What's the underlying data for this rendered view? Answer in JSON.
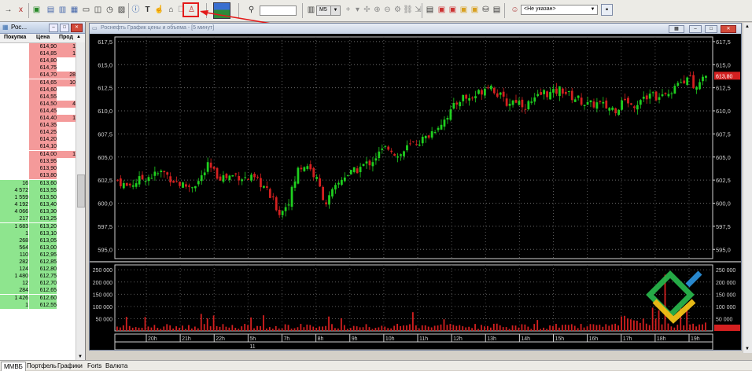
{
  "toolbar": {
    "timeframe": "M5",
    "trader_select": "<Не указан>",
    "search_value": ""
  },
  "orderbook": {
    "title": "Рос...",
    "headers": {
      "buy": "Покупка",
      "price": "Цена",
      "sell": "Прод"
    },
    "asks": [
      {
        "price": "614,90",
        "sell": "1"
      },
      {
        "price": "614,85",
        "sell": "1"
      },
      {
        "price": "614,80",
        "sell": ""
      },
      {
        "price": "614,75",
        "sell": ""
      },
      {
        "price": "614,70",
        "sell": "28"
      },
      {
        "price": "614,65",
        "sell": "10"
      },
      {
        "price": "614,60",
        "sell": ""
      },
      {
        "price": "614,55",
        "sell": ""
      },
      {
        "price": "614,50",
        "sell": "4"
      },
      {
        "price": "614,45",
        "sell": ""
      },
      {
        "price": "614,40",
        "sell": "1"
      },
      {
        "price": "614,35",
        "sell": ""
      },
      {
        "price": "614,25",
        "sell": ""
      },
      {
        "price": "614,20",
        "sell": ""
      },
      {
        "price": "614,10",
        "sell": ""
      },
      {
        "price": "614,00",
        "sell": "1"
      },
      {
        "price": "613,95",
        "sell": ""
      },
      {
        "price": "613,90",
        "sell": ""
      },
      {
        "price": "613,80",
        "sell": ""
      }
    ],
    "bids": [
      {
        "buy": "16",
        "price": "613,60"
      },
      {
        "buy": "4 572",
        "price": "613,55"
      },
      {
        "buy": "1 559",
        "price": "613,50"
      },
      {
        "buy": "4 192",
        "price": "613,40"
      },
      {
        "buy": "4 066",
        "price": "613,30"
      },
      {
        "buy": "217",
        "price": "613,25"
      },
      {
        "buy": "1 683",
        "price": "613,20"
      },
      {
        "buy": "1",
        "price": "613,10"
      },
      {
        "buy": "268",
        "price": "613,05"
      },
      {
        "buy": "564",
        "price": "613,00"
      },
      {
        "buy": "110",
        "price": "612,95"
      },
      {
        "buy": "282",
        "price": "612,85"
      },
      {
        "buy": "124",
        "price": "612,80"
      },
      {
        "buy": "1 480",
        "price": "612,75"
      },
      {
        "buy": "12",
        "price": "612,70"
      },
      {
        "buy": "284",
        "price": "612,65"
      },
      {
        "buy": "1 426",
        "price": "612,60"
      },
      {
        "buy": "1",
        "price": "612,55"
      }
    ]
  },
  "chart": {
    "title": "Роснефть График цены и объема - [5 минут]",
    "price_ticks": [
      "617,5",
      "615,0",
      "612,5",
      "610,0",
      "607,5",
      "605,0",
      "602,5",
      "600,0",
      "597,5",
      "595,0"
    ],
    "price_ticks_right": [
      "617,5",
      "615,0",
      "612,5",
      "610,0",
      "607,5",
      "605,0",
      "602,5",
      "600,0",
      "597,5",
      "595,0"
    ],
    "current_price": "613,80",
    "volume_ticks": [
      "250 000",
      "200 000",
      "150 000",
      "100 000",
      "50 000"
    ],
    "volume_ticks_right": [
      "250 000",
      "200 000",
      "150 000",
      "100 000",
      "50 000"
    ],
    "time_ticks": [
      "20h",
      "21h",
      "22h",
      "5h",
      "7h",
      "8h",
      "9h",
      "10h",
      "11h",
      "12h",
      "13h",
      "14h",
      "15h",
      "16h",
      "17h",
      "18h",
      "19h"
    ],
    "day_marker": "11"
  },
  "chart_data": {
    "type": "candlestick",
    "title": "Роснефть График цены и объема - [5 минут]",
    "ylim": [
      594,
      618
    ],
    "volume_ylim": [
      0,
      270000
    ],
    "time_labels": [
      "20h",
      "21h",
      "22h",
      "5h",
      "7h",
      "8h",
      "9h",
      "10h",
      "11h",
      "12h",
      "13h",
      "14h",
      "15h",
      "16h",
      "17h",
      "18h",
      "19h"
    ],
    "close_path": [
      [
        0,
        602.5
      ],
      [
        2,
        601.8
      ],
      [
        4,
        602.3
      ],
      [
        6,
        602.8
      ],
      [
        8,
        603.0
      ],
      [
        10,
        603.4
      ],
      [
        12,
        602.6
      ],
      [
        14,
        602.0
      ],
      [
        16,
        601.8
      ],
      [
        18,
        602.4
      ],
      [
        20,
        604.0
      ],
      [
        22,
        603.0
      ],
      [
        24,
        602.8
      ],
      [
        26,
        603.1
      ],
      [
        28,
        602.7
      ],
      [
        30,
        602.6
      ],
      [
        32,
        602.0
      ],
      [
        34,
        600.5
      ],
      [
        36,
        598.8
      ],
      [
        38,
        600.5
      ],
      [
        40,
        603.8
      ],
      [
        42,
        604.2
      ],
      [
        44,
        602.5
      ],
      [
        46,
        600.0
      ],
      [
        48,
        601.5
      ],
      [
        50,
        603.0
      ],
      [
        52,
        603.3
      ],
      [
        54,
        604.0
      ],
      [
        56,
        604.5
      ],
      [
        58,
        605.5
      ],
      [
        60,
        606.2
      ],
      [
        62,
        605.0
      ],
      [
        64,
        606.0
      ],
      [
        66,
        606.6
      ],
      [
        68,
        607.0
      ],
      [
        70,
        608.0
      ],
      [
        72,
        609.0
      ],
      [
        74,
        610.2
      ],
      [
        76,
        611.5
      ],
      [
        78,
        611.3
      ],
      [
        80,
        612.0
      ],
      [
        82,
        613.0
      ],
      [
        84,
        611.8
      ],
      [
        86,
        610.8
      ],
      [
        88,
        611.2
      ],
      [
        90,
        610.6
      ],
      [
        92,
        611.0
      ],
      [
        94,
        612.0
      ],
      [
        96,
        611.8
      ],
      [
        98,
        612.4
      ],
      [
        100,
        611.6
      ],
      [
        102,
        611.2
      ],
      [
        104,
        610.6
      ],
      [
        106,
        610.8
      ],
      [
        108,
        610.4
      ],
      [
        110,
        610.2
      ],
      [
        112,
        611.0
      ],
      [
        114,
        610.6
      ],
      [
        116,
        611.5
      ],
      [
        118,
        612.0
      ],
      [
        120,
        611.2
      ],
      [
        122,
        612.0
      ],
      [
        124,
        612.6
      ],
      [
        126,
        614.0
      ],
      [
        128,
        612.2
      ],
      [
        130,
        613.8
      ]
    ]
  },
  "tabs": [
    "ММВБ",
    "Портфель",
    "Графики",
    "Forts",
    "Валюта"
  ]
}
